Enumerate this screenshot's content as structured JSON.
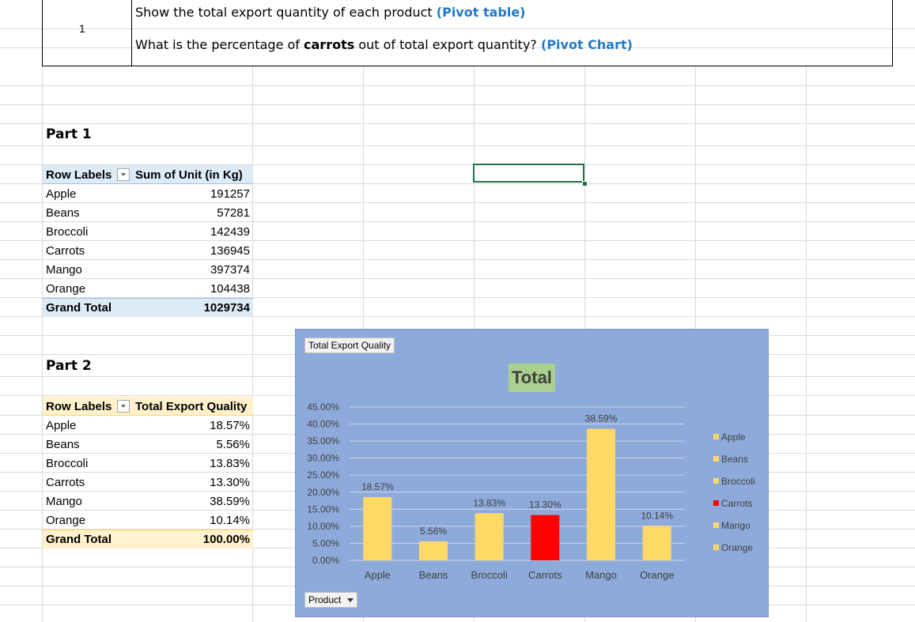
{
  "header": {
    "row_number": "1",
    "line1_text": "Show the total export quantity of each product ",
    "line1_tag": "(Pivot table)",
    "line2_pre": "What is the percentage of ",
    "line2_bold": "carrots",
    "line2_post": " out of total export quantity? ",
    "line2_tag": "(Pivot Chart)"
  },
  "part1": {
    "title": "Part 1",
    "col_row_labels": "Row Labels",
    "col_value": "Sum of Unit (in Kg)",
    "rows": [
      {
        "label": "Apple",
        "value": "191257"
      },
      {
        "label": "Beans",
        "value": "57281"
      },
      {
        "label": "Broccoli",
        "value": "142439"
      },
      {
        "label": "Carrots",
        "value": "136945"
      },
      {
        "label": "Mango",
        "value": "397374"
      },
      {
        "label": "Orange",
        "value": "104438"
      }
    ],
    "total_label": "Grand Total",
    "total_value": "1029734"
  },
  "part2": {
    "title": "Part 2",
    "col_row_labels": "Row Labels",
    "col_value": "Total Export Quality",
    "rows": [
      {
        "label": "Apple",
        "value": "18.57%"
      },
      {
        "label": "Beans",
        "value": "5.56%"
      },
      {
        "label": "Broccoli",
        "value": "13.83%"
      },
      {
        "label": "Carrots",
        "value": "13.30%"
      },
      {
        "label": "Mango",
        "value": "38.59%"
      },
      {
        "label": "Orange",
        "value": "10.14%"
      }
    ],
    "total_label": "Grand Total",
    "total_value": "100.00%"
  },
  "chart_field_value": "Total Export Quality",
  "chart_field_axis": "Product",
  "chart_data": {
    "type": "bar",
    "title": "Total",
    "categories": [
      "Apple",
      "Beans",
      "Broccoli",
      "Carrots",
      "Mango",
      "Orange"
    ],
    "values": [
      18.57,
      5.56,
      13.83,
      13.3,
      38.59,
      10.14
    ],
    "data_labels": [
      "18.57%",
      "5.56%",
      "13.83%",
      "13.30%",
      "38.59%",
      "10.14%"
    ],
    "bar_colors": [
      "#ffd966",
      "#ffd966",
      "#ffd966",
      "#ff0000",
      "#ffd966",
      "#ffd966"
    ],
    "y_ticks": [
      "0.00%",
      "5.00%",
      "10.00%",
      "15.00%",
      "20.00%",
      "25.00%",
      "30.00%",
      "35.00%",
      "40.00%",
      "45.00%"
    ],
    "ylim": [
      0,
      45
    ],
    "grid": true,
    "legend_position": "right",
    "legend": [
      "Apple",
      "Beans",
      "Broccoli",
      "Carrots",
      "Mango",
      "Orange"
    ],
    "xlabel": "",
    "ylabel": ""
  },
  "colors": {
    "pivot1_header": "#ddebf7",
    "pivot2_header": "#fff2cc",
    "chart_bg": "#8eaadb",
    "bar": "#ffd966",
    "highlight_bar": "#ff0000",
    "title_bg": "#a9d08e",
    "selection": "#217346"
  }
}
